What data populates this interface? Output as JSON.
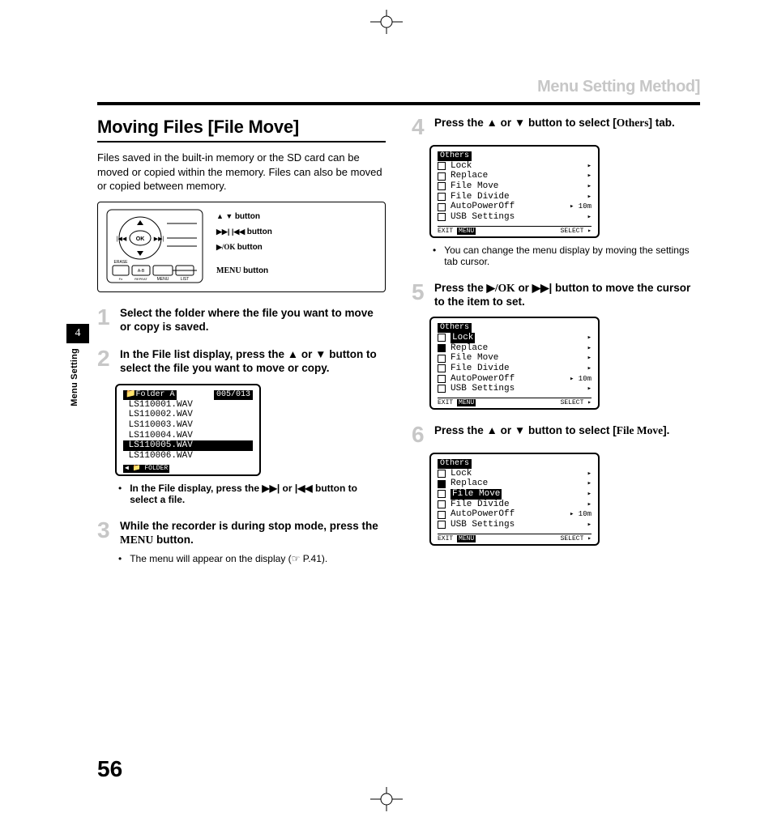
{
  "running_title": "Menu Setting Method]",
  "section_title": "Moving Files [File Move]",
  "intro": "Files saved in the built-in memory or the SD card can be moved or copied within the memory. Files can also be moved or copied between memory.",
  "device_labels": {
    "l1_pre": "▲ ▼ ",
    "l1": "button",
    "l2_pre": "▶▶| |◀◀ ",
    "l2": "button",
    "l3_pre": "▶/OK ",
    "l3": "button",
    "l4_pre": "MENU ",
    "l4": "button"
  },
  "steps_left": [
    {
      "n": "1",
      "text": "Select the folder where the file you want to move or copy is saved."
    },
    {
      "n": "2",
      "text": "In the File list display, press the ▲ or ▼ button to select the file you want to move or copy."
    },
    {
      "n": "3",
      "text": "While the recorder is during stop mode, press the ",
      "bold": "MENU",
      "text2": " button.",
      "sub": "The menu will appear on the display (☞ P.41)."
    }
  ],
  "file_list": {
    "header_left": "📁Folder A",
    "header_right": "005/013",
    "items": [
      "LS110001.WAV",
      "LS110002.WAV",
      "LS110003.WAV",
      "LS110004.WAV",
      "LS110005.WAV",
      "LS110006.WAV"
    ],
    "selected": 4,
    "footer": "◀ 📁 FOLDER"
  },
  "file_list_sub": "In the File display, press the ▶▶| or |◀◀ button to select a file.",
  "steps_right": [
    {
      "n": "4",
      "text": "Press the ▲ or ▼ button to select [",
      "bold": "Others",
      "text2": "] tab."
    },
    {
      "n": "5",
      "text": "Press the ▶",
      "bold": "/OK",
      "text2": " or ▶▶| button to move the cursor to the item to set."
    },
    {
      "n": "6",
      "text": " Press the ▲ or ▼ button to select [",
      "bold": "File Move",
      "text2": "]."
    }
  ],
  "right_sub4": "You can change the menu display by moving the settings tab cursor.",
  "others_menu": {
    "title": "Others",
    "items": [
      {
        "label": "Lock",
        "arrow": "▸"
      },
      {
        "label": "Replace",
        "arrow": "▸"
      },
      {
        "label": "File Move",
        "arrow": "▸"
      },
      {
        "label": "File Divide",
        "arrow": "▸"
      },
      {
        "label": "AutoPowerOff",
        "arrow": "▸",
        "extra": "10m"
      },
      {
        "label": "USB Settings",
        "arrow": "▸"
      }
    ],
    "footer_l": "EXIT",
    "footer_btn": "MENU",
    "footer_r": "SELECT ▸"
  },
  "sel5": 0,
  "sel6": 2,
  "side_tab": "4",
  "side_label": "Menu Setting",
  "pagenum": "56"
}
